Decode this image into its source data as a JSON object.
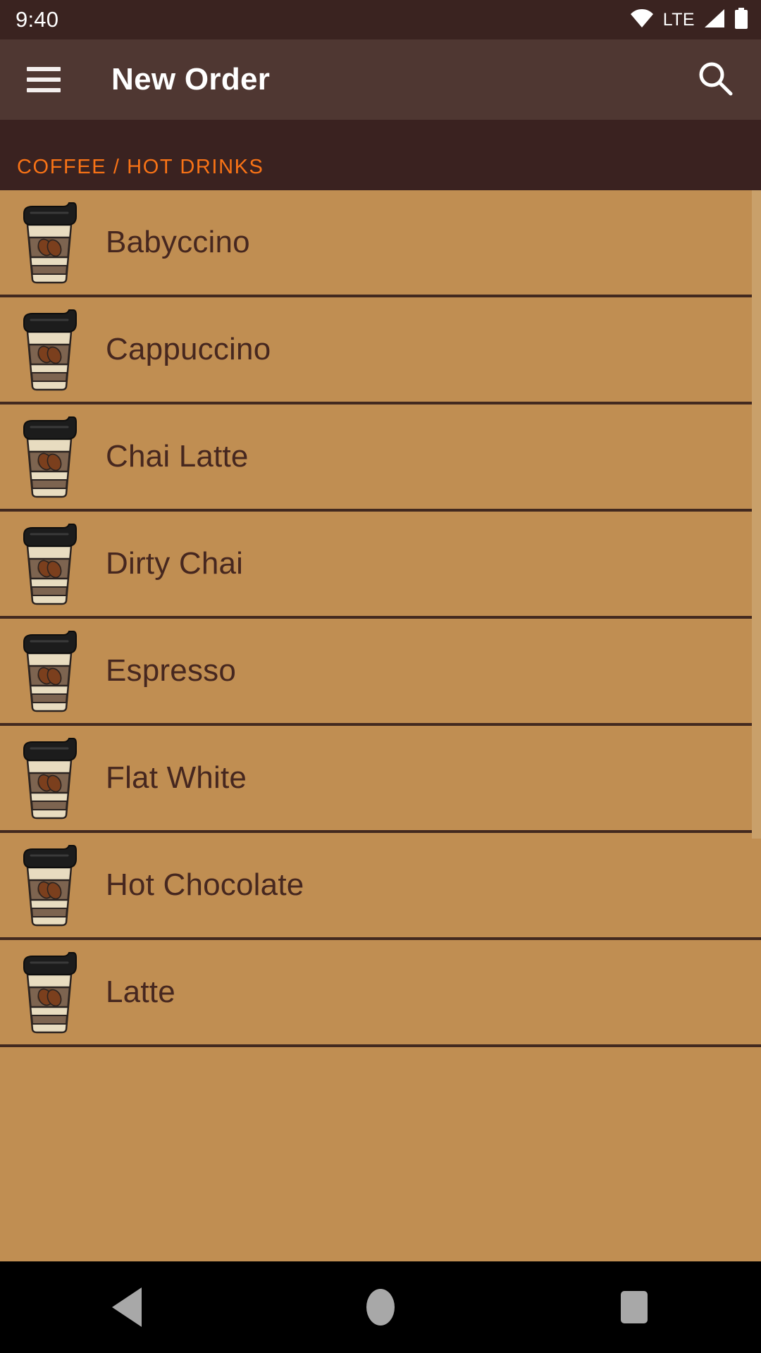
{
  "status_bar": {
    "time": "9:40",
    "network_label": "LTE",
    "icons": [
      "wifi-icon",
      "signal-icon",
      "battery-icon"
    ]
  },
  "app_bar": {
    "menu_icon": "hamburger-menu-icon",
    "title": "New Order",
    "search_icon": "search-icon"
  },
  "breadcrumb": {
    "text": "COFFEE / HOT DRINKS",
    "accent_color": "#f97316"
  },
  "theme": {
    "status_bar_bg": "#3a2320",
    "app_bar_bg": "#4f3732",
    "breadcrumb_bg": "#3a2220",
    "list_bg": "#c08e52",
    "divider": "#42291f",
    "list_text": "#46271f",
    "scrollbar_thumb": "#c9a06a",
    "nav_bar_bg": "#000000",
    "nav_icon": "#a8a8a8"
  },
  "menu": {
    "icon_name": "coffee-cup-icon",
    "items": [
      {
        "label": "Babyccino"
      },
      {
        "label": "Cappuccino"
      },
      {
        "label": "Chai Latte"
      },
      {
        "label": "Dirty Chai"
      },
      {
        "label": "Espresso"
      },
      {
        "label": "Flat White"
      },
      {
        "label": "Hot Chocolate"
      },
      {
        "label": "Latte"
      }
    ]
  },
  "nav_bar": {
    "back_label": "Back",
    "home_label": "Home",
    "recents_label": "Recents"
  }
}
